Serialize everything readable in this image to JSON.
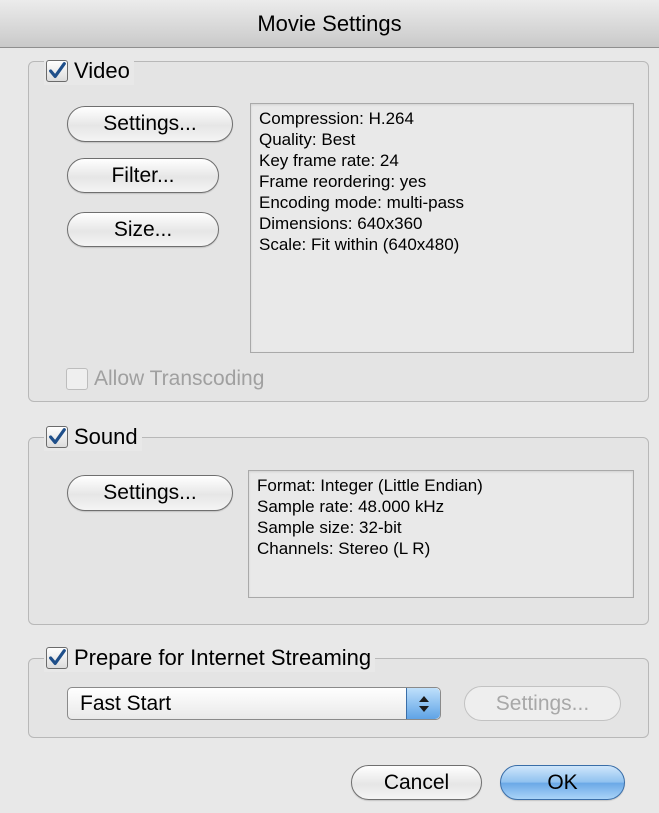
{
  "window": {
    "title": "Movie Settings"
  },
  "video": {
    "label": "Video",
    "checked": true,
    "buttons": {
      "settings": "Settings...",
      "filter": "Filter...",
      "size": "Size..."
    },
    "info": [
      "Compression: H.264",
      "Quality: Best",
      "Key frame rate: 24",
      "Frame reordering: yes",
      "Encoding mode: multi-pass",
      "Dimensions: 640x360",
      "Scale: Fit within (640x480)"
    ],
    "allow_transcoding": {
      "label": "Allow Transcoding",
      "checked": false,
      "enabled": false
    }
  },
  "sound": {
    "label": "Sound",
    "checked": true,
    "buttons": {
      "settings": "Settings..."
    },
    "info": [
      "Format: Integer (Little Endian)",
      "Sample rate: 48.000 kHz",
      "Sample size: 32-bit",
      "Channels: Stereo (L R)"
    ]
  },
  "streaming": {
    "label": "Prepare for Internet Streaming",
    "checked": true,
    "selected_option": "Fast Start",
    "settings_label": "Settings...",
    "settings_enabled": false
  },
  "footer": {
    "cancel_label": "Cancel",
    "ok_label": "OK"
  },
  "colors": {
    "accent": "#6aa8e6",
    "checkmark": "#1f4f8a",
    "disabled_text": "#a0a0a0"
  }
}
